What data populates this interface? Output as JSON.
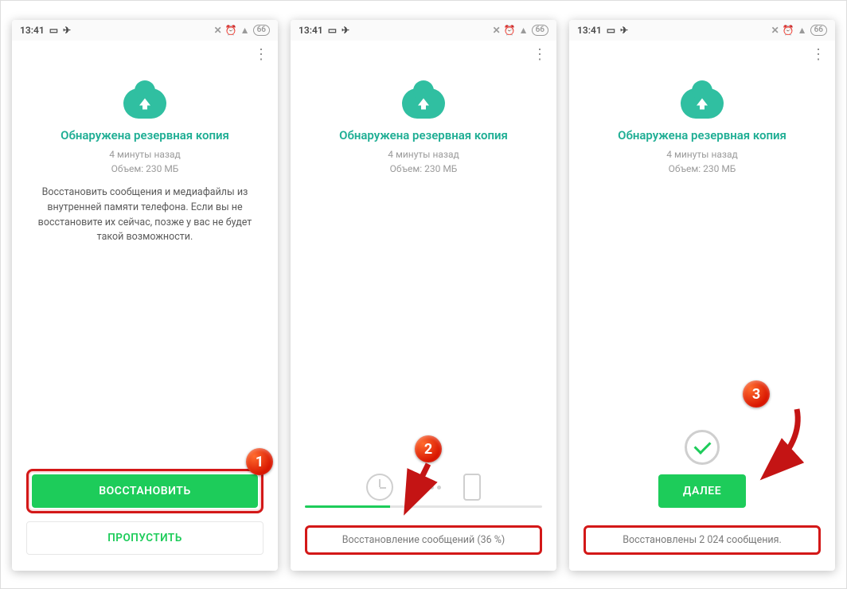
{
  "statusbar": {
    "time": "13:41",
    "battery": "66"
  },
  "common": {
    "title": "Обнаружена резервная копия",
    "backup_time": "4 минуты назад",
    "backup_size": "Объем: 230 МБ"
  },
  "panel1": {
    "description": "Восстановить сообщения и медиафайлы из внутренней памяти телефона. Если вы не восстановите их сейчас, позже у вас не будет такой возможности.",
    "restore_button": "ВОССТАНОВИТЬ",
    "skip_button": "ПРОПУСТИТЬ",
    "badge": "1"
  },
  "panel2": {
    "progress_text": "Восстановление сообщений (36 %)",
    "progress_percent": 36,
    "badge": "2"
  },
  "panel3": {
    "next_button": "ДАЛЕЕ",
    "done_text": "Восстановлены 2 024 сообщения.",
    "badge": "3"
  }
}
